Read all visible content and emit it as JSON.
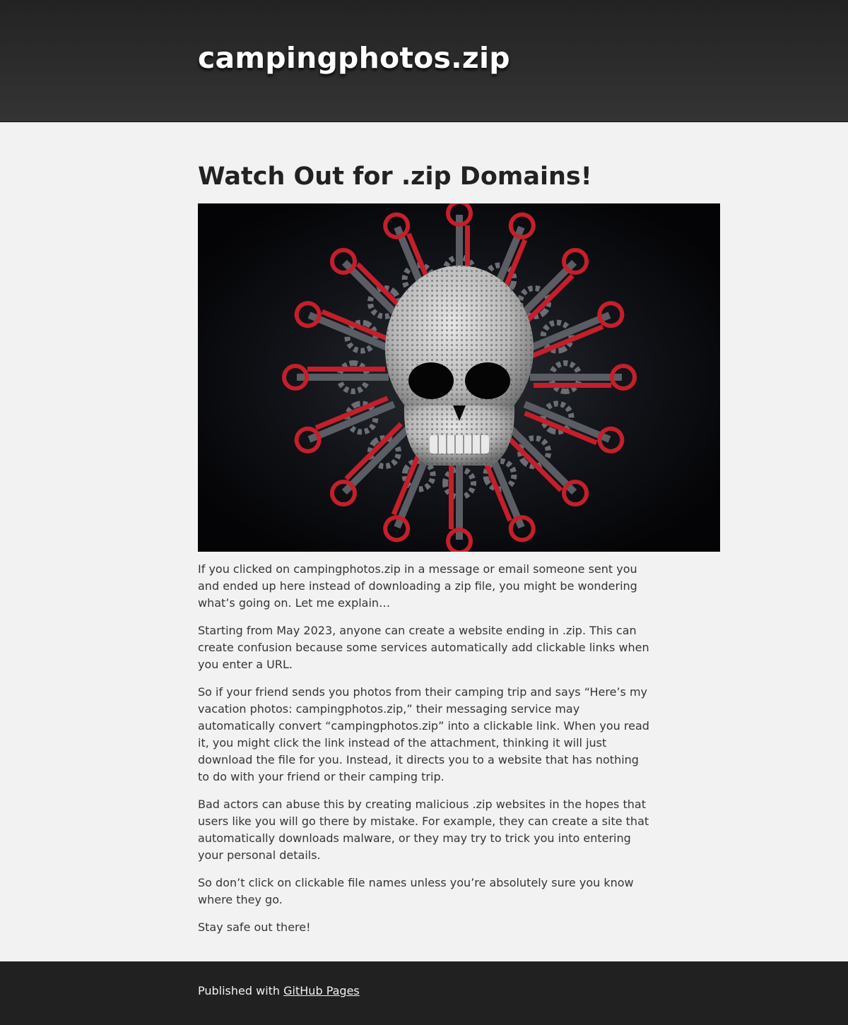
{
  "header": {
    "site_title": "campingphotos.zip"
  },
  "main": {
    "page_title": "Watch Out for .zip Domains!",
    "image": {
      "description_icon": "skull-with-gears-icon"
    },
    "paragraphs": [
      "If you clicked on campingphotos.zip in a message or email someone sent you and ended up here instead of downloading a zip file, you might be wondering what’s going on. Let me explain…",
      "Starting from May 2023, anyone can create a website ending in .zip. This can create confusion because some services automatically add clickable links when you enter a URL.",
      "So if your friend sends you photos from their camping trip and says “Here’s my vacation photos: campingphotos.zip,” their messaging service may automatically convert “campingphotos.zip” into a clickable link. When you read it, you might click the link instead of the attachment, thinking it will just download the file for you. Instead, it directs you to a website that has nothing to do with your friend or their camping trip.",
      "Bad actors can abuse this by creating malicious .zip websites in the hopes that users like you will go there by mistake. For example, they can create a site that automatically downloads malware, or they may try to trick you into entering your personal details.",
      "So don’t click on clickable file names unless you’re absolutely sure you know where they go.",
      "Stay safe out there!"
    ]
  },
  "footer": {
    "published_prefix": "Published with ",
    "link_label": "GitHub Pages"
  },
  "colors": {
    "header_bg": "#2c2c2c",
    "page_bg": "#f2f2f2",
    "footer_bg": "#212121",
    "accent_red": "#c41f2b"
  }
}
